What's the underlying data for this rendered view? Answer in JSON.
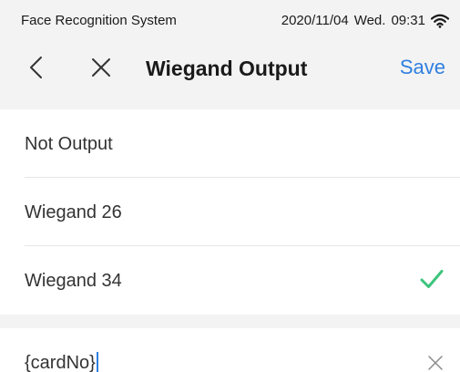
{
  "status_bar": {
    "app_name": "Face Recognition System",
    "date": "2020/11/04",
    "weekday": "Wed.",
    "time": "09:31",
    "wifi_icon": "wifi-icon"
  },
  "nav": {
    "back_icon": "chevron-left-icon",
    "close_icon": "close-icon",
    "title": "Wiegand Output",
    "save_label": "Save"
  },
  "options": [
    {
      "label": "Not Output",
      "selected": false
    },
    {
      "label": "Wiegand 26",
      "selected": false
    },
    {
      "label": "Wiegand 34",
      "selected": true
    }
  ],
  "format_input": {
    "value": "{cardNo}",
    "clear_icon": "clear-icon"
  },
  "colors": {
    "accent": "#2f7fe0",
    "check": "#3cc47c",
    "header_bg": "#f3f3f3"
  }
}
